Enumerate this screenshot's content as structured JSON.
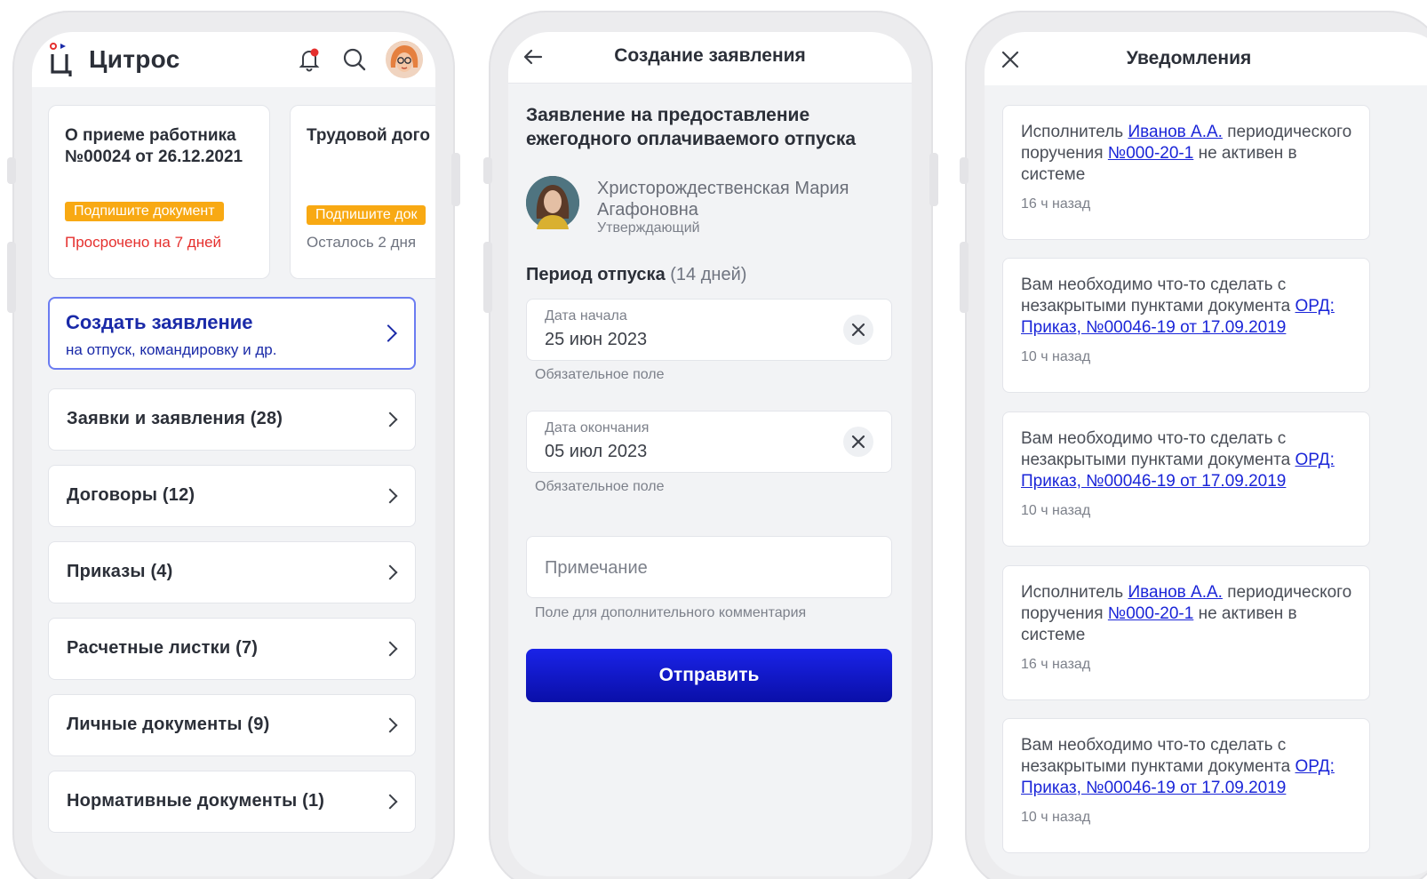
{
  "screen1": {
    "app_name": "Цитрос",
    "doc_cards": [
      {
        "title": "О приеме работника №00024 от 26.12.2021",
        "badge": "Подпишите документ",
        "status": "Просрочено на 7 дней"
      },
      {
        "title": "Трудовой дого",
        "badge": "Подпишите док",
        "status": "Осталось 2 дня"
      }
    ],
    "create": {
      "title": "Создать заявление",
      "subtitle": "на отпуск, командировку и др."
    },
    "menu": [
      {
        "label": "Заявки и заявления (28)"
      },
      {
        "label": "Договоры (12)"
      },
      {
        "label": "Приказы (4)"
      },
      {
        "label": "Расчетные листки (7)"
      },
      {
        "label": "Личные документы (9)"
      },
      {
        "label": "Нормативные документы (1)"
      }
    ],
    "colors": {
      "badge": "#f8a913",
      "overdue": "#e5302e",
      "accent": "#1a2aa8"
    },
    "icons": [
      "bell-icon",
      "search-icon",
      "chevron-right-icon"
    ]
  },
  "screen2": {
    "header_title": "Создание заявления",
    "form_title": "Заявление на предоставление ежегодного оплачиваемого отпуска",
    "person": {
      "name": "Христорождественская Мария Агафоновна",
      "role": "Утверждающий"
    },
    "period_label": "Период отпуска",
    "period_days": "(14 дней)",
    "start": {
      "label": "Дата начала",
      "value": "25 июн 2023",
      "hint": "Обязательное поле"
    },
    "end": {
      "label": "Дата окончания",
      "value": "05 июл 2023",
      "hint": "Обязательное поле"
    },
    "note": {
      "placeholder": "Примечание",
      "hint": "Поле для дополнительного комментария"
    },
    "submit_label": "Отправить",
    "colors": {
      "submit_top": "#1a23e8",
      "submit_bottom": "#0a0fa8"
    }
  },
  "screen3": {
    "header_title": "Уведомления",
    "notifications": [
      {
        "type": "executor",
        "text1": "Исполнитель ",
        "link1": "Иванов А.А.",
        "text2": " периодического поручения ",
        "link2": "№000-20-1",
        "text3": " не активен в системе",
        "time": "16 ч назад"
      },
      {
        "type": "doc",
        "text1": "Вам необходимо что-то сделать с незакрытыми пунктами документа ",
        "link1": "ОРД: Приказ, №00046-19 от 17.09.2019",
        "time": "10 ч назад"
      },
      {
        "type": "doc",
        "text1": "Вам необходимо что-то сделать с незакрытыми пунктами документа ",
        "link1": "ОРД: Приказ, №00046-19 от 17.09.2019",
        "time": "10 ч назад"
      },
      {
        "type": "executor",
        "text1": "Исполнитель ",
        "link1": "Иванов А.А.",
        "text2": " периодического поручения ",
        "link2": "№000-20-1",
        "text3": " не активен в системе",
        "time": "16 ч назад"
      },
      {
        "type": "doc",
        "text1": "Вам необходимо что-то сделать с незакрытыми пунктами документа ",
        "link1": "ОРД: Приказ, №00046-19 от 17.09.2019",
        "time": "10 ч назад"
      }
    ],
    "colors": {
      "link": "#1a25d8"
    }
  }
}
